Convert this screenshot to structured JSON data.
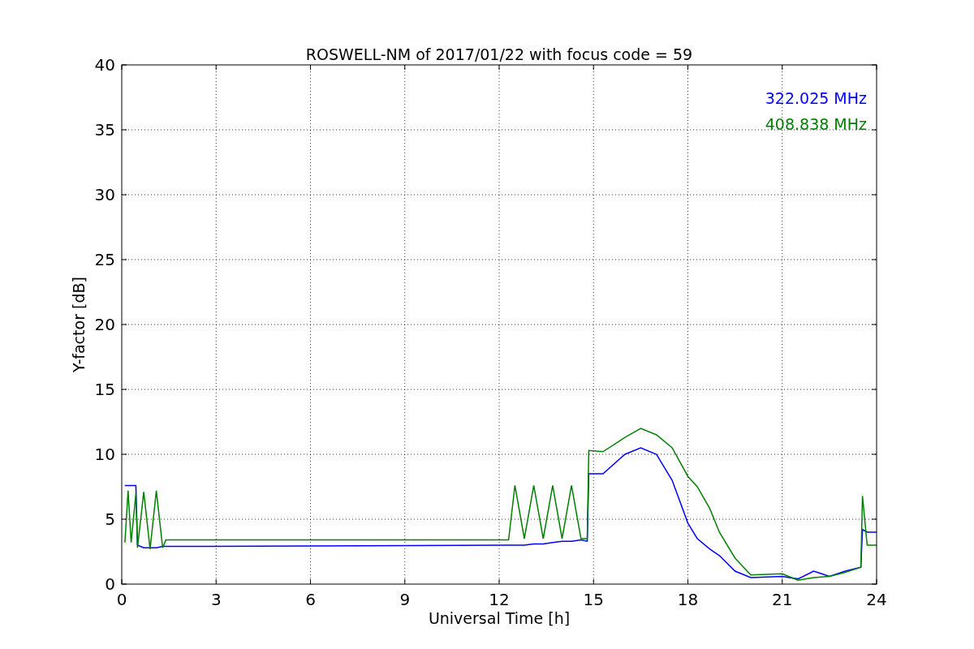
{
  "chart_data": {
    "type": "line",
    "title": "ROSWELL-NM of 2017/01/22 with focus code = 59",
    "xlabel": "Universal Time [h]",
    "ylabel": "Y-factor [dB]",
    "x": [
      0.1,
      0.2,
      0.3,
      0.45,
      0.5,
      0.7,
      0.9,
      1.1,
      1.3,
      1.4,
      12.3,
      12.5,
      12.8,
      13.1,
      13.4,
      13.7,
      14.0,
      14.3,
      14.6,
      14.8,
      14.85,
      15.3,
      16,
      16.5,
      17,
      17.5,
      18,
      18.3,
      18.7,
      19,
      19.5,
      20,
      21,
      21.5,
      22,
      22.5,
      23,
      23.5,
      23.55,
      23.7,
      24
    ],
    "series": [
      {
        "name": "322.025 MHz",
        "color": "#0000ff",
        "values": [
          7.6,
          7.6,
          7.6,
          7.6,
          3.0,
          2.8,
          2.8,
          2.8,
          2.9,
          2.9,
          3.0,
          3.0,
          3.0,
          3.1,
          3.1,
          3.2,
          3.3,
          3.3,
          3.4,
          3.3,
          8.5,
          8.5,
          10,
          10.5,
          10,
          8,
          4.7,
          3.5,
          2.7,
          2.2,
          1.0,
          0.5,
          0.6,
          0.4,
          1.0,
          0.6,
          1.0,
          1.3,
          4.2,
          4.0,
          4.0
        ]
      },
      {
        "name": "408.838 MHz",
        "color": "#008000",
        "values": [
          3.2,
          7.2,
          3.2,
          7.0,
          2.8,
          7.1,
          2.7,
          7.2,
          2.8,
          3.4,
          3.4,
          7.6,
          3.5,
          7.6,
          3.5,
          7.6,
          3.5,
          7.6,
          3.5,
          3.5,
          10.3,
          10.2,
          11.3,
          12,
          11.5,
          10.5,
          8.3,
          7.5,
          5.8,
          4.0,
          2.0,
          0.7,
          0.8,
          0.3,
          0.5,
          0.6,
          0.9,
          1.3,
          6.8,
          3.0,
          3.0
        ]
      }
    ],
    "xlim": [
      0,
      24
    ],
    "ylim": [
      0,
      40
    ],
    "xticks": [
      0,
      3,
      6,
      9,
      12,
      15,
      18,
      21,
      24
    ],
    "yticks": [
      0,
      5,
      10,
      15,
      20,
      25,
      30,
      35,
      40
    ],
    "grid": true
  }
}
